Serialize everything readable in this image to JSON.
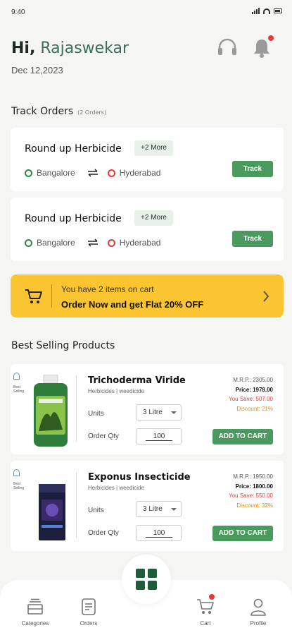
{
  "status": {
    "time": "9:40"
  },
  "header": {
    "greeting_hi": "Hi,",
    "user_name": "Rajaswekar",
    "date": "Dec 12,2023",
    "support_icon": "headset-icon",
    "notification_icon": "bell-icon"
  },
  "track_orders": {
    "title": "Track Orders",
    "count_label": "(2 Orders)",
    "orders": [
      {
        "product": "Round up Herbicide",
        "more": "+2 More",
        "from": "Bangalore",
        "to": "Hyderabad",
        "track_label": "Track"
      },
      {
        "product": "Round up Herbicide",
        "more": "+2 More",
        "from": "Bangalore",
        "to": "Hyderabad",
        "track_label": "Track"
      }
    ]
  },
  "cart_banner": {
    "line1": "You have 2 items on cart",
    "line2": "Order Now and get Flat 20% OFF",
    "icon": "cart-icon"
  },
  "best_selling": {
    "title": "Best Selling Products",
    "badge_text": "Best Selling",
    "products": [
      {
        "name": "Trichoderma Viride",
        "category": "Herbicides | weedicide",
        "units_label": "Units",
        "units_value": "3 Litre",
        "qty_label": "Order Qty",
        "qty_value": "100",
        "mrp": "M.R.P.:  2305.00",
        "price": "Price:  1978.00",
        "save": "You Save:  507.00",
        "discount": "Discount:  21%",
        "add_label": "ADD TO CART",
        "bottle_color": "#2f7d3a",
        "cap_color": "#e8e8e8"
      },
      {
        "name": "Exponus Insecticide",
        "category": "Herbicides | weedicide",
        "units_label": "Units",
        "units_value": "3 Litre",
        "qty_label": "Order Qty",
        "qty_value": "100",
        "mrp": "M.R.P.:  1950.00",
        "price": "Price:  1800.00",
        "save": "You Save:  550.00",
        "discount": "Discount:  32%",
        "add_label": "ADD TO CART",
        "box_color": "#1b1e3c"
      }
    ]
  },
  "bottom_nav": {
    "items": [
      {
        "label": "Categories",
        "icon": "categories-icon"
      },
      {
        "label": "Orders",
        "icon": "orders-icon"
      },
      {
        "label": "Cart",
        "icon": "cart-icon"
      },
      {
        "label": "Profile",
        "icon": "profile-icon"
      }
    ],
    "center_icon": "grid-icon"
  },
  "colors": {
    "brand_green": "#4b9a5d",
    "dark_green": "#1f5c3b",
    "banner_yellow": "#fbc531",
    "alert_red": "#e53935"
  }
}
